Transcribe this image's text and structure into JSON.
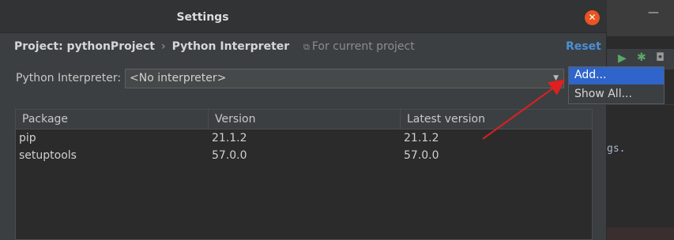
{
  "dialog": {
    "title": "Settings",
    "close_glyph": "✕"
  },
  "breadcrumb": {
    "project": "Project: pythonProject",
    "separator": "›",
    "page": "Python Interpreter"
  },
  "scope": {
    "icon": "copy-icon",
    "glyph": "⧉",
    "label": "For current project"
  },
  "reset_label": "Reset",
  "interpreter": {
    "label": "Python Interpreter:",
    "value": "<No interpreter>",
    "arrow_glyph": "▼"
  },
  "dropdown_menu": {
    "items": [
      "Add...",
      "Show All..."
    ],
    "highlighted": "Add..."
  },
  "packages_table": {
    "headers": [
      "Package",
      "Version",
      "Latest version"
    ],
    "rows": [
      [
        "pip",
        "21.1.2",
        "21.1.2"
      ],
      [
        "setuptools",
        "57.0.0",
        "57.0.0"
      ]
    ]
  },
  "background_ide": {
    "minimize_glyph": "—",
    "run_glyph": "▶",
    "debug_glyph": "✱",
    "coverage_glyph": "◘",
    "code_fragment": "gs."
  },
  "colors": {
    "dialog_bg": "#3c3f41",
    "close_button": "#e95420",
    "reset_link": "#4a8fd8",
    "selection": "#2f65ca",
    "annotation_arrow": "#e02020"
  }
}
